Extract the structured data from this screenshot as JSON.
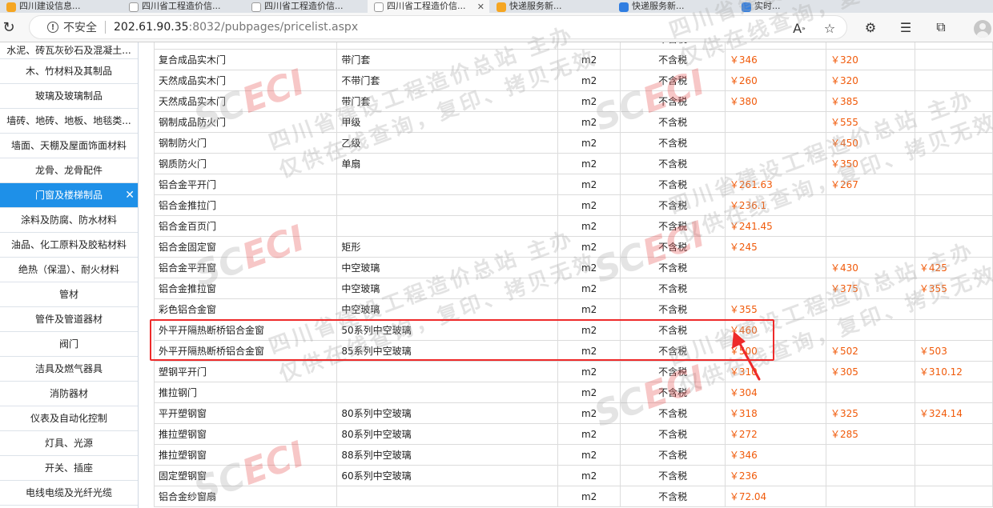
{
  "browser": {
    "tabs": [
      {
        "title": "四川建设信息..."
      },
      {
        "title": "四川省工程造价信..."
      },
      {
        "title": "四川省工程造价信..."
      },
      {
        "title": "四川省工程造价信..."
      },
      {
        "title": "快递服务新..."
      },
      {
        "title": "快递服务新..."
      },
      {
        "title": "实时..."
      }
    ],
    "security_label": "不安全",
    "url_host": "202.61.90.35",
    "url_path": ":8032/pubpages/pricelist.aspx",
    "colors": {
      "accent": "#1e90e8",
      "price": "#f05a0a",
      "highlight": "#ee2a2a"
    }
  },
  "sidebar": {
    "items": [
      {
        "label": "水泥、砖瓦灰砂石及混凝土..."
      },
      {
        "label": "木、竹材料及其制品"
      },
      {
        "label": "玻璃及玻璃制品"
      },
      {
        "label": "墙砖、地砖、地板、地毯类..."
      },
      {
        "label": "墙面、天棚及屋面饰面材料"
      },
      {
        "label": "龙骨、龙骨配件"
      },
      {
        "label": "门窗及楼梯制品",
        "active": true
      },
      {
        "label": "涂料及防腐、防水材料"
      },
      {
        "label": "油品、化工原料及胶粘材料"
      },
      {
        "label": "绝热（保温）、耐火材料"
      },
      {
        "label": "管材"
      },
      {
        "label": "管件及管道器材"
      },
      {
        "label": "阀门"
      },
      {
        "label": "洁具及燃气器具"
      },
      {
        "label": "消防器材"
      },
      {
        "label": "仪表及自动化控制"
      },
      {
        "label": "灯具、光源"
      },
      {
        "label": "开关、插座"
      },
      {
        "label": "电线电缆及光纤光缆"
      }
    ]
  },
  "price_table": {
    "rows": [
      {
        "name": "",
        "spec": "",
        "unit": "",
        "tax": "不含税",
        "p1": "",
        "p2": "",
        "p3": ""
      },
      {
        "name": "复合成品实木门",
        "spec": "带门套",
        "unit": "m2",
        "tax": "不含税",
        "p1": "￥346",
        "p2": "￥320",
        "p3": ""
      },
      {
        "name": "天然成品实木门",
        "spec": "不带门套",
        "unit": "m2",
        "tax": "不含税",
        "p1": "￥260",
        "p2": "￥320",
        "p3": ""
      },
      {
        "name": "天然成品实木门",
        "spec": "带门套",
        "unit": "m2",
        "tax": "不含税",
        "p1": "￥380",
        "p2": "￥385",
        "p3": ""
      },
      {
        "name": "钢制成品防火门",
        "spec": "甲级",
        "unit": "m2",
        "tax": "不含税",
        "p1": "",
        "p2": "￥555",
        "p3": ""
      },
      {
        "name": "钢制防火门",
        "spec": "乙级",
        "unit": "m2",
        "tax": "不含税",
        "p1": "",
        "p2": "￥450",
        "p3": ""
      },
      {
        "name": "钢质防火门",
        "spec": "单扇",
        "unit": "m2",
        "tax": "不含税",
        "p1": "",
        "p2": "￥350",
        "p3": ""
      },
      {
        "name": "铝合金平开门",
        "spec": "",
        "unit": "m2",
        "tax": "不含税",
        "p1": "￥261.63",
        "p2": "￥267",
        "p3": ""
      },
      {
        "name": "铝合金推拉门",
        "spec": "",
        "unit": "m2",
        "tax": "不含税",
        "p1": "￥236.1",
        "p2": "",
        "p3": ""
      },
      {
        "name": "铝合金百页门",
        "spec": "",
        "unit": "m2",
        "tax": "不含税",
        "p1": "￥241.45",
        "p2": "",
        "p3": ""
      },
      {
        "name": "铝合金固定窗",
        "spec": "矩形",
        "unit": "m2",
        "tax": "不含税",
        "p1": "￥245",
        "p2": "",
        "p3": ""
      },
      {
        "name": "铝合金平开窗",
        "spec": "中空玻璃",
        "unit": "m2",
        "tax": "不含税",
        "p1": "",
        "p2": "￥430",
        "p3": "￥425"
      },
      {
        "name": "铝合金推拉窗",
        "spec": "中空玻璃",
        "unit": "m2",
        "tax": "不含税",
        "p1": "",
        "p2": "￥375",
        "p3": "￥355"
      },
      {
        "name": "彩色铝合金窗",
        "spec": "中空玻璃",
        "unit": "m2",
        "tax": "不含税",
        "p1": "￥355",
        "p2": "",
        "p3": ""
      },
      {
        "name": "外平开隔热断桥铝合金窗",
        "spec": "50系列中空玻璃",
        "unit": "m2",
        "tax": "不含税",
        "p1": "￥460",
        "p2": "",
        "p3": ""
      },
      {
        "name": "外平开隔热断桥铝合金窗",
        "spec": "85系列中空玻璃",
        "unit": "m2",
        "tax": "不含税",
        "p1": "￥500",
        "p2": "￥502",
        "p3": "￥503"
      },
      {
        "name": "塑钢平开门",
        "spec": "",
        "unit": "m2",
        "tax": "不含税",
        "p1": "￥310",
        "p2": "￥305",
        "p3": "￥310.12"
      },
      {
        "name": "推拉钢门",
        "spec": "",
        "unit": "m2",
        "tax": "不含税",
        "p1": "￥304",
        "p2": "",
        "p3": ""
      },
      {
        "name": "平开塑钢窗",
        "spec": "80系列中空玻璃",
        "unit": "m2",
        "tax": "不含税",
        "p1": "￥318",
        "p2": "￥325",
        "p3": "￥324.14"
      },
      {
        "name": "推拉塑钢窗",
        "spec": "80系列中空玻璃",
        "unit": "m2",
        "tax": "不含税",
        "p1": "￥272",
        "p2": "￥285",
        "p3": ""
      },
      {
        "name": "推拉塑钢窗",
        "spec": "88系列中空玻璃",
        "unit": "m2",
        "tax": "不含税",
        "p1": "￥346",
        "p2": "",
        "p3": ""
      },
      {
        "name": "固定塑钢窗",
        "spec": "60系列中空玻璃",
        "unit": "m2",
        "tax": "不含税",
        "p1": "￥236",
        "p2": "",
        "p3": ""
      },
      {
        "name": "铝合金纱窗扇",
        "spec": "",
        "unit": "m2",
        "tax": "不含税",
        "p1": "￥72.04",
        "p2": "",
        "p3": ""
      }
    ]
  },
  "watermark": {
    "line1": "四川省建设工程造价总站 主办",
    "line2": "仅供在线查询，复印、拷贝无效",
    "logo_s": "SC",
    "logo_e": "ECI"
  }
}
